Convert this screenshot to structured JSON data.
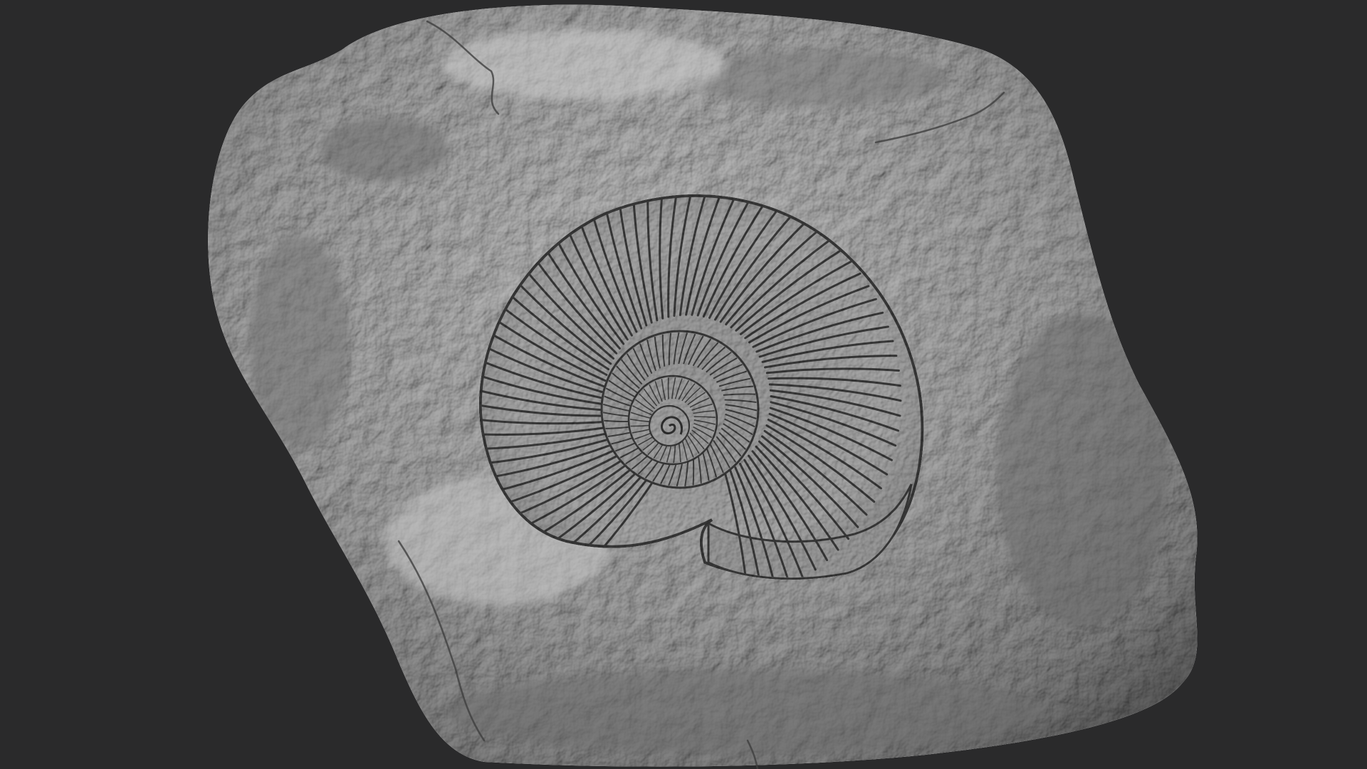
{
  "scene": {
    "subject": "sculpted-rock-with-ammonite-fossil",
    "colors": {
      "background": "#2a2a2b",
      "rock_light": "#b9b9b9",
      "rock_mid": "#8f8f8f",
      "rock_dark": "#5a5a5a",
      "shell_light": "#a8a8a8",
      "shell_groove": "#3c3c3c"
    }
  }
}
